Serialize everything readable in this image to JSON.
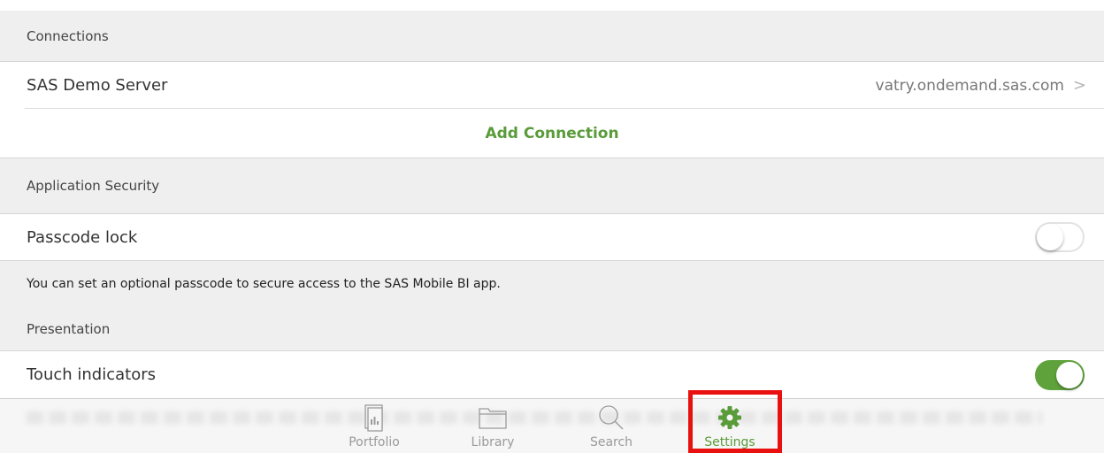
{
  "sections": {
    "connections": {
      "header": "Connections",
      "server_label": "SAS Demo Server",
      "server_host": "vatry.ondemand.sas.com",
      "chevron": ">",
      "add_connection": "Add Connection"
    },
    "security": {
      "header": "Application Security",
      "passcode_label": "Passcode lock",
      "passcode_enabled": false,
      "note": "You can set an optional passcode to secure access to the SAS Mobile BI app."
    },
    "presentation": {
      "header": "Presentation",
      "touch_label": "Touch indicators",
      "touch_enabled": true
    }
  },
  "tab_bar": {
    "tabs": [
      {
        "label": "Portfolio",
        "icon": "portfolio-icon"
      },
      {
        "label": "Library",
        "icon": "folder-icon"
      },
      {
        "label": "Search",
        "icon": "search-icon"
      },
      {
        "label": "Settings",
        "icon": "gear-icon"
      }
    ],
    "active": "Settings"
  },
  "colors": {
    "accent": "#5a9b3a",
    "highlight": "#e8110f",
    "section_bg": "#efeff0"
  }
}
